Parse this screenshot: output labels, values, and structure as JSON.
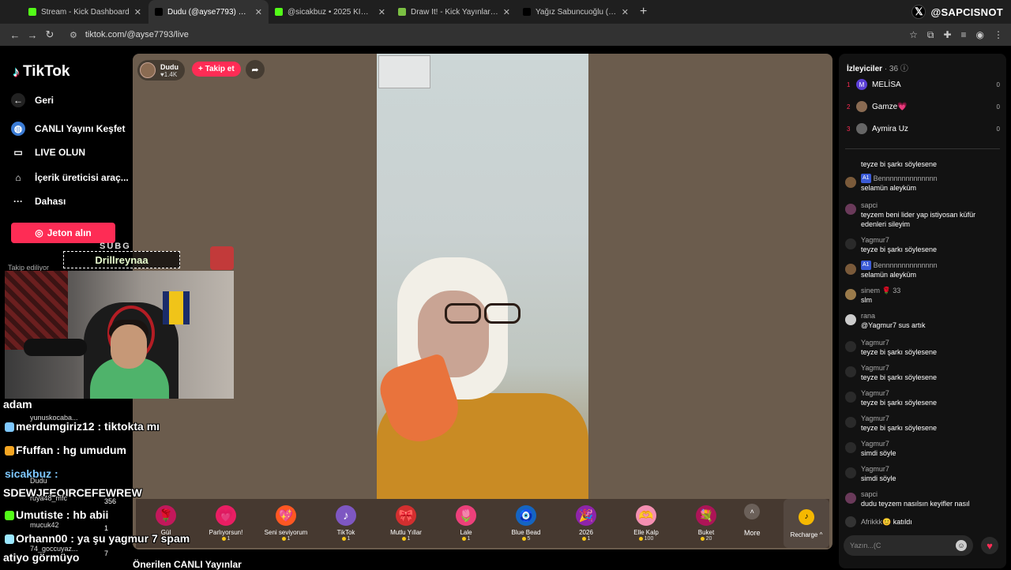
{
  "browser": {
    "tabs": [
      {
        "label": "Stream - Kick Dashboard",
        "color": "#53fc18"
      },
      {
        "label": "Dudu (@ayse7793) CANLI Y",
        "color": "#000000",
        "active": true
      },
      {
        "label": "@sicakbuz • 2025 KICK WRAPP",
        "color": "#53fc18"
      },
      {
        "label": "Draw It! - Kick Yayınları İçin Çizi",
        "color": "#7bc043"
      },
      {
        "label": "Yağız Sabuncuoğlu (@yagosab",
        "color": "#000000"
      }
    ],
    "new_tab": "+",
    "url": "tiktok.com/@ayse7793/live",
    "overlay_handle": "@SAPCISNOT"
  },
  "sidebar": {
    "logo": "TikTok",
    "items": [
      {
        "label": "Geri",
        "icon": "back-arrow-icon"
      },
      {
        "label": "CANLI Yayını Keşfet",
        "icon": "globe-icon"
      },
      {
        "label": "LIVE OLUN",
        "icon": "video-camera-icon"
      },
      {
        "label": "İçerik üreticisi araç...",
        "icon": "home-icon"
      },
      {
        "label": "Dahası",
        "icon": "more-dots-icon"
      }
    ],
    "coin_button": "Jeton alın",
    "following_label": "Takip ediliyor"
  },
  "stream": {
    "host_name": "Dudu",
    "host_likes": "♥1.4K",
    "follow_button": "+ Takip et",
    "gifts": [
      {
        "name": "Gül",
        "price": "1",
        "icon": "🌹",
        "color": "#c2185b"
      },
      {
        "name": "Parlıyorsun!",
        "price": "1",
        "icon": "💗",
        "color": "#e91e63"
      },
      {
        "name": "Seni seviyorum",
        "price": "1",
        "icon": "💖",
        "color": "#ff5722"
      },
      {
        "name": "TikTok",
        "price": "1",
        "icon": "♪",
        "color": "#7e57c2"
      },
      {
        "name": "Mutlu Yıllar",
        "price": "1",
        "icon": "🎀",
        "color": "#d32f2f"
      },
      {
        "name": "Lale",
        "price": "1",
        "icon": "🌷",
        "color": "#ec407a"
      },
      {
        "name": "Blue Bead",
        "price": "5",
        "icon": "🧿",
        "color": "#1565c0"
      },
      {
        "name": "2026",
        "price": "1",
        "icon": "🎉",
        "color": "#8e24aa"
      },
      {
        "name": "Elle Kalp",
        "price": "100",
        "icon": "🫶",
        "color": "#f48fb1"
      },
      {
        "name": "Buket",
        "price": "20",
        "icon": "💐",
        "color": "#ad1457"
      }
    ],
    "more_label": "More",
    "recharge_label": "Recharge ^",
    "suggested_title": "Önerilen CANLI Yayınlar"
  },
  "overlay": {
    "sub_tag": "SUBG",
    "sub_name": "Drillreynaa",
    "chat": [
      {
        "text": "adam",
        "size": "big",
        "color": "#ffffff"
      },
      {
        "text": "yunuskocaba...",
        "size": "small",
        "color": "#dddddd"
      },
      {
        "text": "merdumgiriz12 : tiktokta mı",
        "size": "big",
        "color": "#ffffff",
        "user_color": "#7ec8ff"
      },
      {
        "text": "Ffuffan : hg umudum",
        "size": "big",
        "color": "#ffffff",
        "user_color": "#f5a623"
      },
      {
        "text": "sicakbuz :",
        "size": "big",
        "color": "#7ec8ff"
      },
      {
        "text": "Dudu",
        "size": "small",
        "color": "#dddddd"
      },
      {
        "text": "SDEWJFEOIRCEFEWREW",
        "size": "big",
        "color": "#ffffff"
      },
      {
        "text": "ruya48_mfc",
        "size": "small",
        "color": "#dddddd"
      },
      {
        "text": "Umutiste : hb abii",
        "size": "big",
        "color": "#ffffff",
        "user_color": "#53fc18"
      },
      {
        "text": "mucuk42",
        "size": "small",
        "color": "#dddddd"
      },
      {
        "text": "Orhann00 : ya şu yagmur 7 spam",
        "size": "big",
        "color": "#ffffff",
        "user_color": "#9be7ff"
      },
      {
        "text": "74_goccuyaz...",
        "size": "small",
        "color": "#dddddd"
      },
      {
        "text": "atiyo görmüyo",
        "size": "big",
        "color": "#ffffff"
      }
    ],
    "side_numbers": [
      "356",
      "1",
      "7"
    ]
  },
  "right_panel": {
    "viewers_title": "İzleyiciler",
    "viewers_count": "· 36",
    "top_viewers": [
      {
        "rank": "1",
        "name": "MELİSA",
        "score": "0",
        "avatar_letter": "M",
        "avatar_color": "#5b3fd6"
      },
      {
        "rank": "2",
        "name": "Gamze💗",
        "score": "0",
        "avatar_letter": "",
        "avatar_color": "#8a6b52"
      },
      {
        "rank": "3",
        "name": "Aymira Uz",
        "score": "0",
        "avatar_letter": "",
        "avatar_color": "#666666"
      }
    ],
    "messages": [
      {
        "user": "",
        "msg": "teyze bi şarkı söylesene",
        "level": "",
        "avatar": "#2a2a2a"
      },
      {
        "user": "Bennnnnnnnnnnnnn",
        "msg": "selamün aleyküm",
        "level": "A1",
        "avatar": "#7a5a3a"
      },
      {
        "user": "sapci",
        "msg": "teyzem beni lider yap istiyosan küfür edenleri sileyim",
        "level": "",
        "avatar": "#6a3a5a"
      },
      {
        "user": "Yagmur7",
        "msg": "teyze bi şarkı söylesene",
        "level": "",
        "avatar": "#2a2a2a"
      },
      {
        "user": "Bennnnnnnnnnnnnn",
        "msg": "selamün aleyküm",
        "level": "A1",
        "avatar": "#7a5a3a"
      },
      {
        "user": "sinem 🌹 33",
        "msg": "slm",
        "level": "",
        "avatar": "#9a7a4a"
      },
      {
        "user": "rana",
        "msg": "@Yagmur7 sus artık",
        "level": "",
        "avatar": "#cccccc"
      },
      {
        "user": "Yagmur7",
        "msg": "teyze bi şarkı söylesene",
        "level": "",
        "avatar": "#2a2a2a"
      },
      {
        "user": "Yagmur7",
        "msg": "teyze bi şarkı söylesene",
        "level": "",
        "avatar": "#2a2a2a"
      },
      {
        "user": "Yagmur7",
        "msg": "teyze bi şarkı söylesene",
        "level": "",
        "avatar": "#2a2a2a"
      },
      {
        "user": "Yagmur7",
        "msg": "teyze bi şarkı söylesene",
        "level": "",
        "avatar": "#2a2a2a"
      },
      {
        "user": "Yagmur7",
        "msg": "simdi söyle",
        "level": "",
        "avatar": "#2a2a2a"
      },
      {
        "user": "Yagmur7",
        "msg": "simdi söyle",
        "level": "",
        "avatar": "#2a2a2a"
      },
      {
        "user": "sapci",
        "msg": "dudu teyzem nasılsın keyifler nasıl",
        "level": "",
        "avatar": "#6a3a5a"
      }
    ],
    "join_user": "Afrikkk😊",
    "join_text": "katıldı",
    "input_placeholder": "Yazın...(C"
  }
}
